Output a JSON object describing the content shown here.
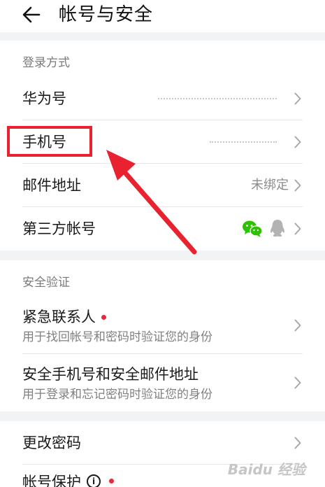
{
  "header": {
    "title": "帐号与安全"
  },
  "sections": [
    {
      "title": "登录方式",
      "items": [
        {
          "label": "华为号"
        },
        {
          "label": "手机号"
        },
        {
          "label": "邮件地址",
          "value": "未绑定"
        },
        {
          "label": "第三方帐号"
        }
      ]
    },
    {
      "title": "安全验证",
      "items": [
        {
          "label": "紧急联系人",
          "subtitle": "用于找回帐号和密码时验证您的身份"
        },
        {
          "label": "安全手机号和安全邮件地址",
          "subtitle": "用于登录和忘记密码时验证您的身份"
        }
      ]
    },
    {
      "items": [
        {
          "label": "更改密码"
        },
        {
          "label": "帐号保护"
        }
      ]
    }
  ],
  "watermark": "Baidu 经验",
  "icons": {
    "back": "back-arrow-icon",
    "chevron": "chevron-right-icon",
    "wechat": "wechat-icon",
    "qq": "qq-icon",
    "info": "info-icon"
  },
  "colors": {
    "accent": "#e8222f",
    "wechat": "#2dc100",
    "qq": "#b3b3b3",
    "dot": "#e8293b"
  }
}
